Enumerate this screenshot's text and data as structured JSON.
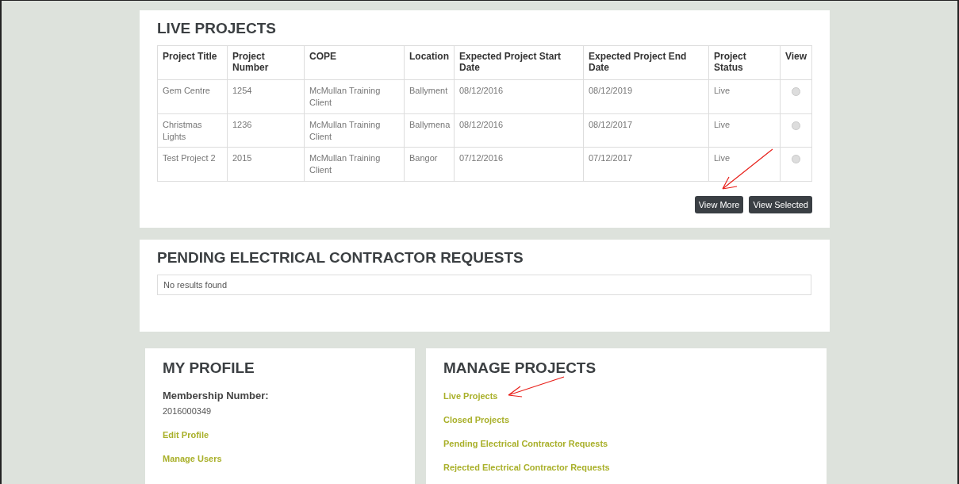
{
  "live_projects": {
    "title": "LIVE PROJECTS",
    "columns": [
      "Project Title",
      "Project Number",
      "COPE",
      "Location",
      "Expected Project Start Date",
      "Expected Project End Date",
      "Project Status",
      "View"
    ],
    "rows": [
      {
        "cells": [
          "Gem Centre",
          "1254",
          "McMullan Training Client",
          "Ballyment",
          "08/12/2016",
          "08/12/2019",
          "Live"
        ],
        "selected": false
      },
      {
        "cells": [
          "Christmas Lights",
          "1236",
          "McMullan Training Client",
          "Ballymena",
          "08/12/2016",
          "08/12/2017",
          "Live"
        ],
        "selected": false
      },
      {
        "cells": [
          "Test Project 2",
          "2015",
          "McMullan Training Client",
          "Bangor",
          "07/12/2016",
          "07/12/2017",
          "Live"
        ],
        "selected": false
      }
    ],
    "buttons": [
      "View More",
      "View Selected"
    ]
  },
  "pending_requests": {
    "title": "PENDING ELECTRICAL CONTRACTOR REQUESTS",
    "empty_message": "No results found"
  },
  "my_profile": {
    "title": "MY PROFILE",
    "membership_label": "Membership Number:",
    "membership_number": "2016000349",
    "links": [
      "Edit Profile",
      "Manage Users"
    ]
  },
  "manage_projects": {
    "title": "MANAGE PROJECTS",
    "links": [
      "Live Projects",
      "Closed Projects",
      "Pending Electrical Contractor Requests",
      "Rejected Electrical Contractor Requests"
    ]
  }
}
